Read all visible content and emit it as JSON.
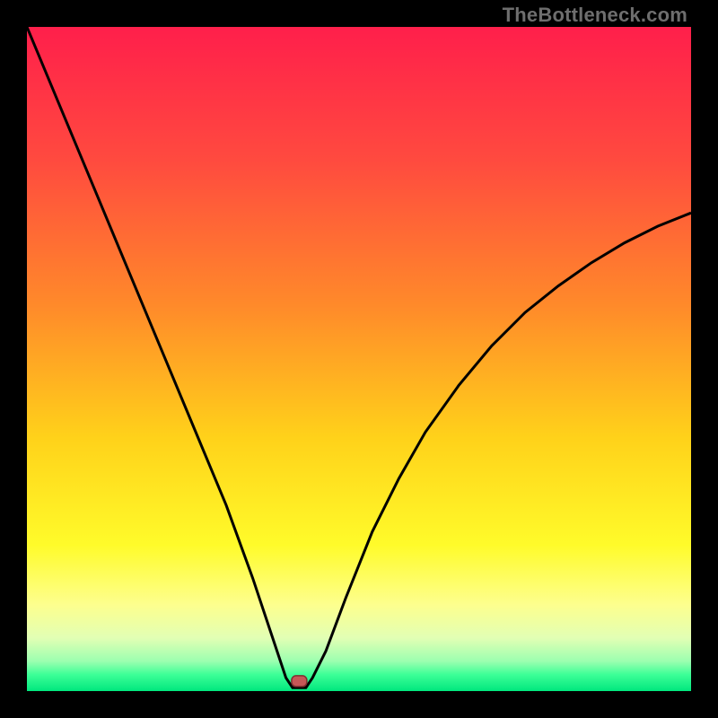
{
  "watermark": "TheBottleneck.com",
  "chart_data": {
    "type": "line",
    "title": "",
    "xlabel": "",
    "ylabel": "",
    "xlim": [
      0,
      100
    ],
    "ylim": [
      0,
      100
    ],
    "grid": false,
    "legend": false,
    "curve_minimum_x": 40,
    "marker": {
      "x": 41,
      "y": 1.5,
      "color_fill": "#c55757",
      "color_stroke": "#7f2f2f"
    },
    "series": [
      {
        "name": "bottleneck-curve",
        "color": "#000000",
        "x": [
          0,
          5,
          10,
          15,
          20,
          25,
          30,
          34,
          36,
          38,
          39,
          40,
          41,
          42,
          43,
          45,
          48,
          52,
          56,
          60,
          65,
          70,
          75,
          80,
          85,
          90,
          95,
          100
        ],
        "y": [
          100,
          88,
          76,
          64,
          52,
          40,
          28,
          17,
          11,
          5,
          2,
          0.5,
          0.5,
          0.5,
          2,
          6,
          14,
          24,
          32,
          39,
          46,
          52,
          57,
          61,
          64.5,
          67.5,
          70,
          72
        ]
      }
    ],
    "background_gradient": {
      "type": "vertical",
      "stops": [
        {
          "offset": 0.0,
          "color": "#ff1f4b"
        },
        {
          "offset": 0.2,
          "color": "#ff4a3f"
        },
        {
          "offset": 0.42,
          "color": "#ff8a2a"
        },
        {
          "offset": 0.62,
          "color": "#ffd21a"
        },
        {
          "offset": 0.78,
          "color": "#fffb2a"
        },
        {
          "offset": 0.87,
          "color": "#fdff8e"
        },
        {
          "offset": 0.92,
          "color": "#e2ffb4"
        },
        {
          "offset": 0.955,
          "color": "#9cffb0"
        },
        {
          "offset": 0.975,
          "color": "#3dff97"
        },
        {
          "offset": 1.0,
          "color": "#00e77e"
        }
      ]
    }
  }
}
